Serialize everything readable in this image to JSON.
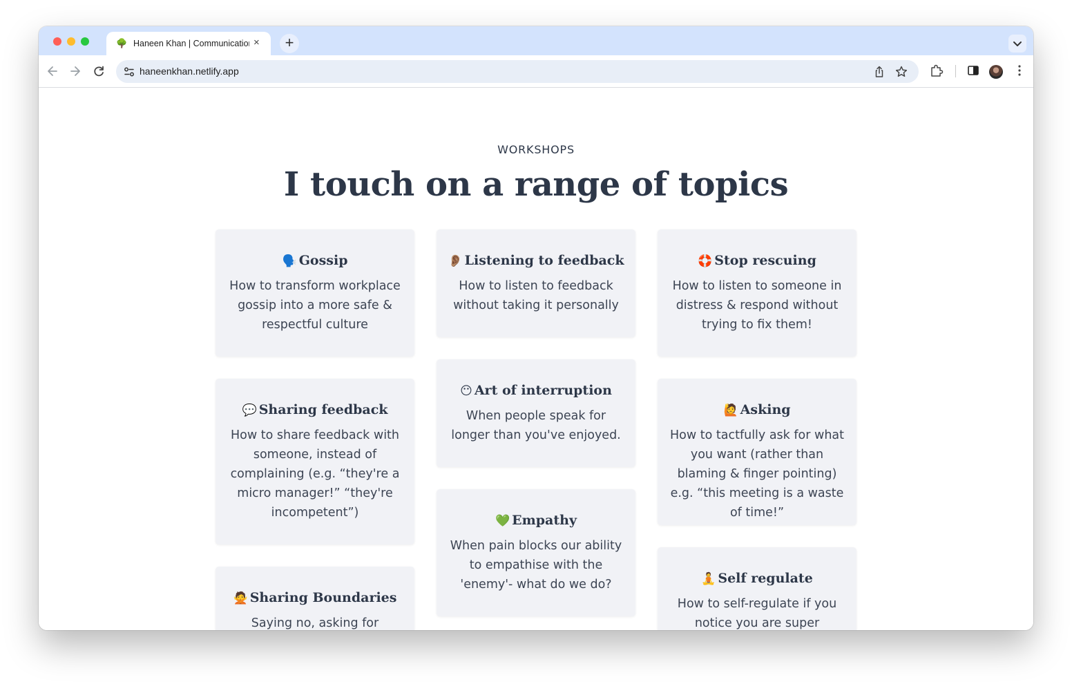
{
  "browser": {
    "tab": {
      "favicon": "🌳",
      "title": "Haneen Khan | Communication",
      "close_icon": "×"
    },
    "new_tab_icon": "+",
    "url": "haneenkhan.netlify.app"
  },
  "section": {
    "eyebrow": "WORKSHOPS",
    "heading": "I touch on a range of topics"
  },
  "cards": [
    {
      "emoji": "🗣️",
      "title": "Gossip",
      "description": "How to transform workplace gossip into a more safe & respectful culture"
    },
    {
      "emoji": "👂🏽",
      "title": "Listening to feedback",
      "description": "How to listen to feedback without taking it personally"
    },
    {
      "emoji": "🛟",
      "title": "Stop rescuing",
      "description": "How to listen to someone in distress & respond without trying to fix them!"
    },
    {
      "emoji": "💬",
      "title": "Sharing feedback",
      "description": "How to share feedback with someone, instead of complaining (e.g. “they're a micro manager!” “they're incompetent”)"
    },
    {
      "emoji": "😶",
      "title": "Art of interruption",
      "description": "When people speak for longer than you've enjoyed."
    },
    {
      "emoji": "🙋",
      "title": "Asking",
      "description": "How to tactfully ask for what you want (rather than blaming & finger pointing) e.g. “this meeting is a waste of time!”"
    },
    {
      "emoji": "🙅",
      "title": "Sharing Boundaries",
      "description": "Saying no, asking for"
    },
    {
      "emoji": "💚",
      "title": "Empathy",
      "description": "When pain blocks our ability to empathise with the 'enemy'- what do we do?"
    },
    {
      "emoji": "🧘",
      "title": "Self regulate",
      "description": "How to self-regulate if you notice you are super triggered"
    }
  ]
}
